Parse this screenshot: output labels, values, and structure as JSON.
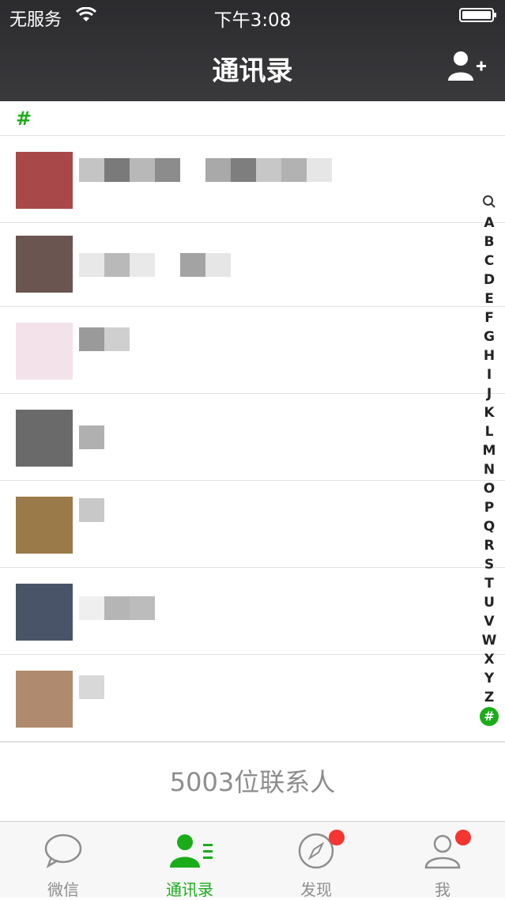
{
  "status": {
    "carrier": "无服务",
    "time": "下午3:08"
  },
  "nav": {
    "title": "通讯录"
  },
  "section": {
    "header": "#"
  },
  "index_bar": [
    "A",
    "B",
    "C",
    "D",
    "E",
    "F",
    "G",
    "H",
    "I",
    "J",
    "K",
    "L",
    "M",
    "N",
    "O",
    "P",
    "Q",
    "R",
    "S",
    "T",
    "U",
    "V",
    "W",
    "X",
    "Y",
    "Z",
    "#"
  ],
  "footer": {
    "count_label": "5003位联系人"
  },
  "tabs": [
    {
      "label": "微信",
      "icon": "chat-icon",
      "badge": false
    },
    {
      "label": "通讯录",
      "icon": "contacts-icon",
      "badge": false,
      "active": true
    },
    {
      "label": "发现",
      "icon": "compass-icon",
      "badge": true
    },
    {
      "label": "我",
      "icon": "person-icon",
      "badge": true
    }
  ],
  "colors": {
    "accent": "#1aad19",
    "badge": "#f43530",
    "topbar": "#2f2f32"
  }
}
